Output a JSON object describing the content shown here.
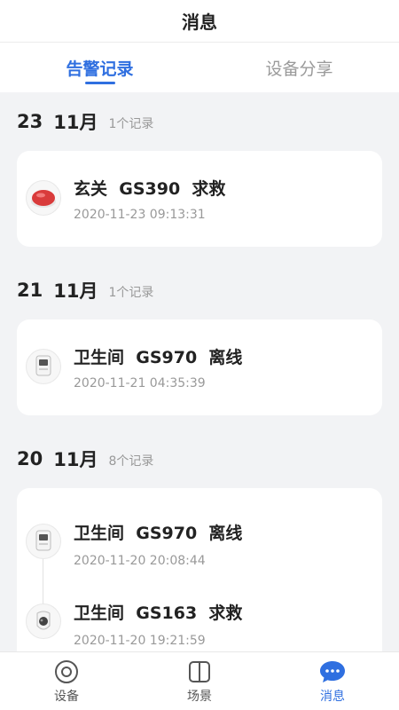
{
  "header": {
    "title": "消息"
  },
  "tabs": [
    {
      "label": "告警记录",
      "active": true
    },
    {
      "label": "设备分享",
      "active": false
    }
  ],
  "groups": [
    {
      "day": "23",
      "month": "11月",
      "count": "1个记录",
      "records": [
        {
          "title": "玄关  GS390  求救",
          "time": "2020-11-23 09:13:31",
          "icon": "red-sos-button-icon"
        }
      ]
    },
    {
      "day": "21",
      "month": "11月",
      "count": "1个记录",
      "records": [
        {
          "title": "卫生间  GS970  离线",
          "time": "2020-11-21 04:35:39",
          "icon": "device-sensor-icon"
        }
      ]
    },
    {
      "day": "20",
      "month": "11月",
      "count": "8个记录",
      "records": [
        {
          "title": "卫生间  GS970  离线",
          "time": "2020-11-20 20:08:44",
          "icon": "device-sensor-icon"
        },
        {
          "title": "卫生间  GS163  求救",
          "time": "2020-11-20 19:21:59",
          "icon": "sos-pendant-icon"
        }
      ]
    }
  ],
  "tabbar": [
    {
      "label": "设备",
      "icon": "device-icon",
      "active": false
    },
    {
      "label": "场景",
      "icon": "scene-icon",
      "active": false
    },
    {
      "label": "消息",
      "icon": "message-icon",
      "active": true
    }
  ],
  "colors": {
    "accent": "#2f6fe0",
    "background": "#f2f3f5"
  }
}
